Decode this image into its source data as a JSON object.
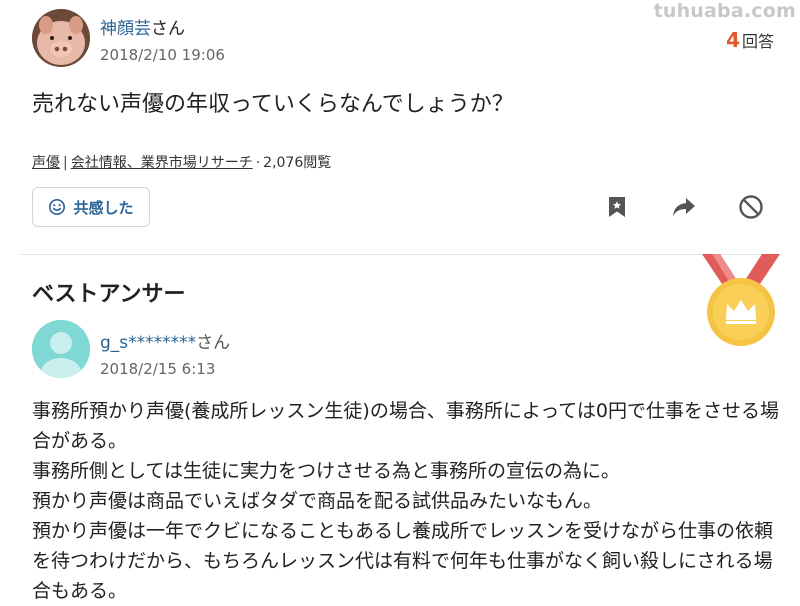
{
  "question": {
    "user_name": "神顔芸",
    "user_suffix": "さん",
    "date": "2018/2/10 19:06",
    "answer_count": "4",
    "answer_count_label": "回答",
    "text": "売れない声優の年収っていくらなんでしょうか？",
    "category_primary": "声優",
    "category_secondary": "会社情報、業界市場リサーチ",
    "category_separator": "|",
    "views": "2,076閲覧",
    "views_separator": "·",
    "react_label": "共感した"
  },
  "watermark": "tuhuaba.com",
  "best_answer": {
    "title": "ベストアンサー",
    "user_name": "g_s********",
    "user_suffix": "さん",
    "date": "2018/2/15 6:13",
    "paragraphs": [
      "事務所預かり声優(養成所レッスン生徒)の場合、事務所によっては0円で仕事をさせる場合がある。",
      "事務所側としては生徒に実力をつけさせる為と事務所の宣伝の為に。",
      "預かり声優は商品でいえばタダで商品を配る試供品みたいなもん。",
      "預かり声優は一年でクビになることもあるし養成所でレッスンを受けながら仕事の依頼を待つわけだから、もちろんレッスン代は有料で何年も仕事がなく飼い殺しにされる場合もある。"
    ]
  },
  "colors": {
    "accent_orange": "#e0582b",
    "link_blue": "#2a6496",
    "medal_gold": "#f6c445",
    "ribbon_red": "#e25b5b",
    "avatar_teal": "#7fd8d4"
  },
  "icons": {
    "bookmark": "bookmark-icon",
    "share": "share-arrow-icon",
    "block": "block-icon",
    "smile": "smile-icon",
    "medal": "medal-crown-icon"
  }
}
